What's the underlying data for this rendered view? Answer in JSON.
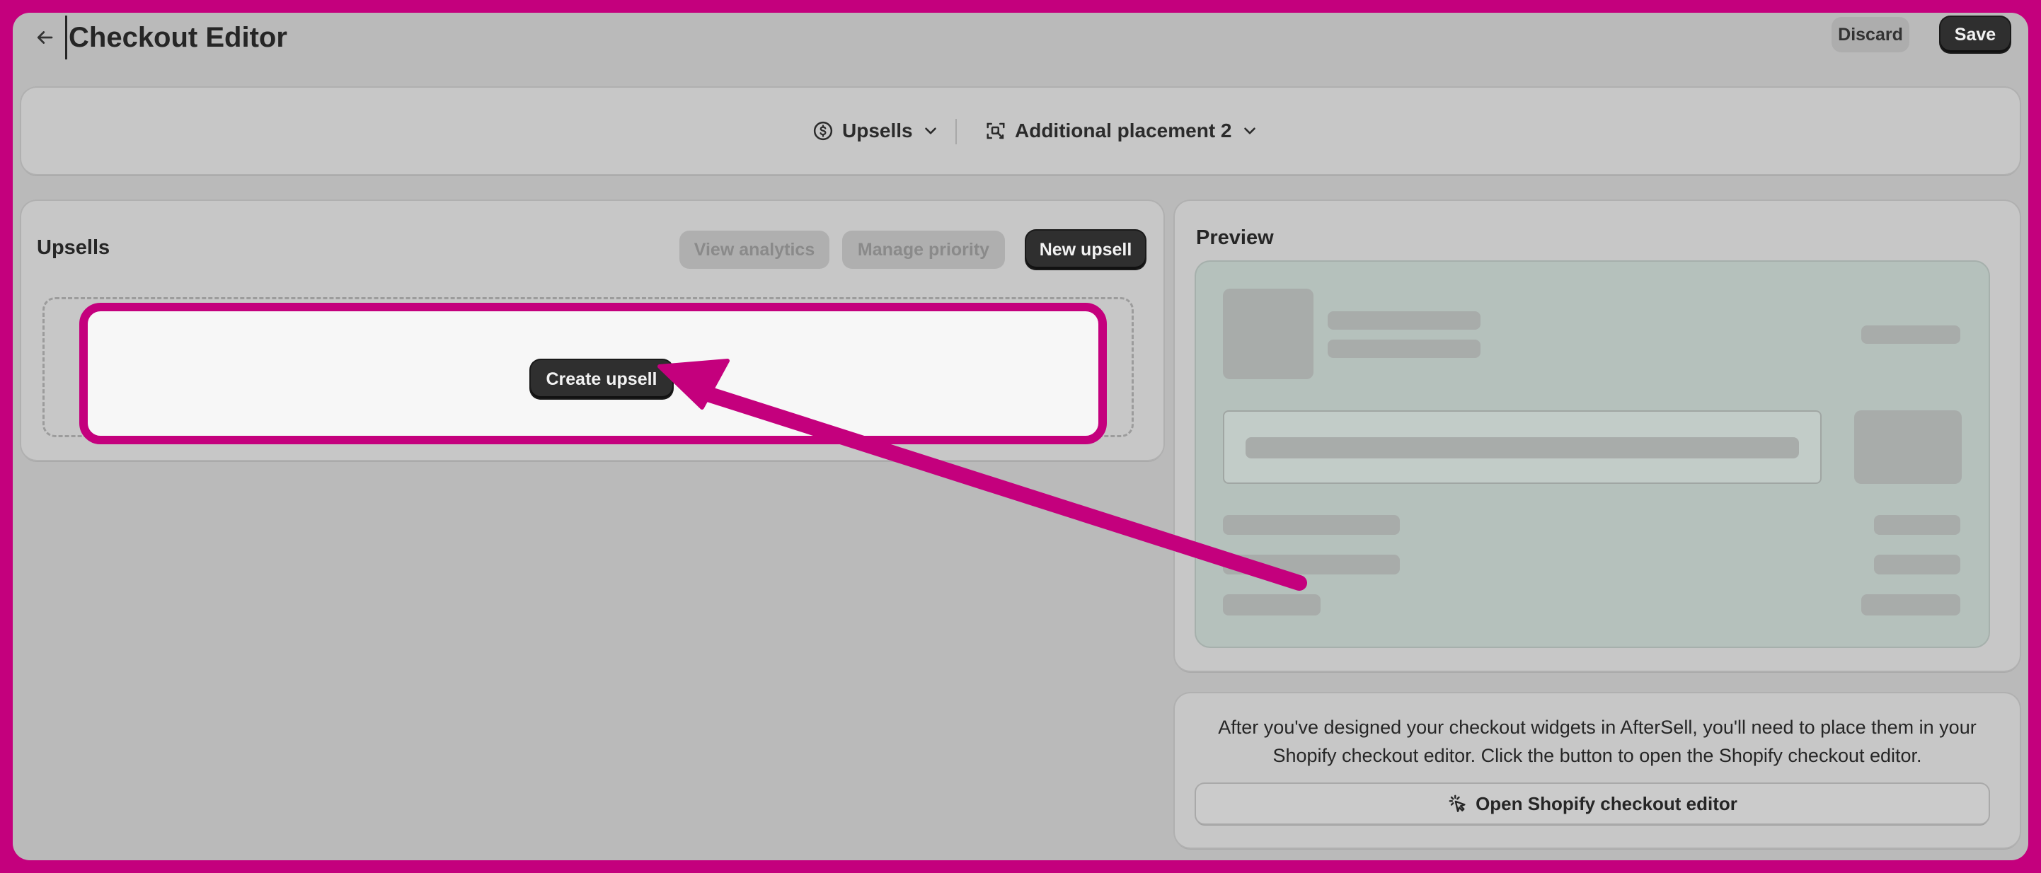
{
  "header": {
    "title": "Checkout Editor",
    "discard_label": "Discard",
    "save_label": "Save"
  },
  "selectors": {
    "widget_type": "Upsells",
    "placement": "Additional placement 2"
  },
  "upsells": {
    "title": "Upsells",
    "view_analytics_label": "View analytics",
    "manage_priority_label": "Manage priority",
    "new_upsell_label": "New upsell",
    "create_upsell_label": "Create upsell"
  },
  "preview": {
    "title": "Preview"
  },
  "info": {
    "text": "After you've designed your checkout widgets in AfterSell, you'll need to place them in your Shopify checkout editor. Click the button to open the Shopify checkout editor.",
    "open_editor_label": "Open Shopify checkout editor"
  },
  "colors": {
    "annotation": "#c4007d",
    "background": "#bababa",
    "card": "#c7c7c7",
    "primary_button": "#2f2f2f",
    "preview_background": "#b5c1bc"
  },
  "icons": {
    "back": "arrow-left-icon",
    "widget_type": "dollar-circle-icon",
    "placement": "placement-target-icon",
    "dropdown": "chevron-down-icon",
    "open_editor": "cursor-click-icon"
  }
}
